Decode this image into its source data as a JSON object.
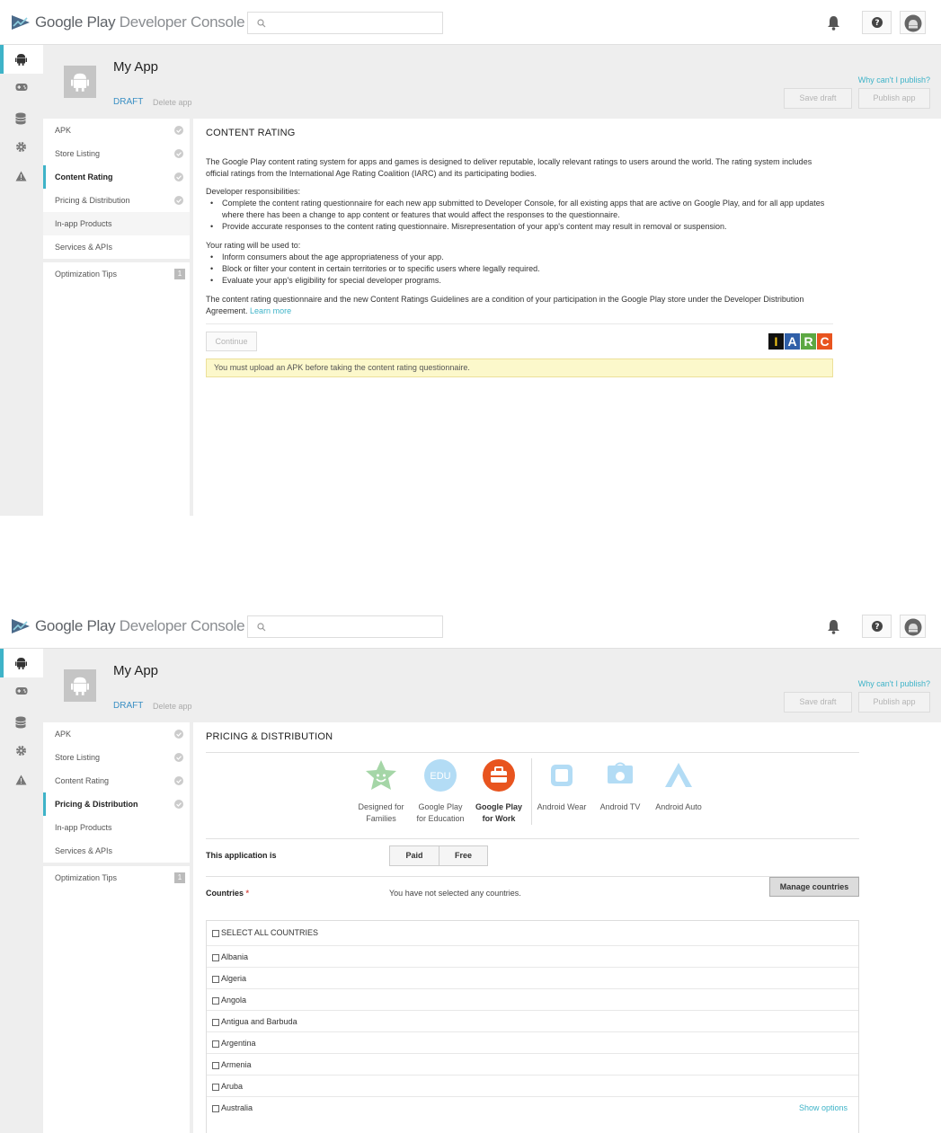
{
  "header": {
    "logo_google_play": "Google Play",
    "logo_dev_console": "Developer Console"
  },
  "app": {
    "title": "My App",
    "status": "DRAFT",
    "delete_label": "Delete app",
    "why_cant_publish": "Why can't I publish?",
    "save_draft": "Save draft",
    "publish_app": "Publish app"
  },
  "sidenav": {
    "items": [
      {
        "label": "APK"
      },
      {
        "label": "Store Listing"
      },
      {
        "label": "Content Rating"
      },
      {
        "label": "Pricing & Distribution"
      },
      {
        "label": "In-app Products"
      },
      {
        "label": "Services & APIs"
      }
    ],
    "optimization_tips": "Optimization Tips",
    "optimization_count": "1"
  },
  "content_rating": {
    "title": "CONTENT RATING",
    "intro": "The Google Play content rating system for apps and games is designed to deliver reputable, locally relevant ratings to users around the world. The rating system includes official ratings from the International Age Rating Coalition (IARC) and its participating bodies.",
    "dev_resp_heading": "Developer responsibilities:",
    "dev_resp": [
      "Complete the content rating questionnaire for each new app submitted to Developer Console, for all existing apps that are active on Google Play, and for all app updates where there has been a change to app content or features that would affect the responses to the questionnaire.",
      "Provide accurate responses to the content rating questionnaire. Misrepresentation of your app's content may result in removal or suspension."
    ],
    "usage_heading": "Your rating will be used to:",
    "usage": [
      "Inform consumers about the age appropriateness of your app.",
      "Block or filter your content in certain territories or to specific users where legally required.",
      "Evaluate your app's eligibility for special developer programs."
    ],
    "closing": "The content rating questionnaire and the new Content Ratings Guidelines are a condition of your participation in the Google Play store under the Developer Distribution Agreement.",
    "learn_more": "Learn more",
    "continue": "Continue",
    "iarc_letters": [
      "I",
      "A",
      "R",
      "C"
    ],
    "iarc_colors": [
      "#f7c815",
      "#2f5fa8",
      "#5ca842",
      "#e8541f"
    ],
    "notice": "You must upload an APK before taking the content rating questionnaire."
  },
  "pricing": {
    "title": "PRICING & DISTRIBUTION",
    "programs": [
      {
        "line1": "Designed for",
        "line2": "Families",
        "icon": "families-star-icon"
      },
      {
        "line1": "Google Play",
        "line2": "for Education",
        "icon": "edu-icon",
        "icon_text": "EDU"
      },
      {
        "line1": "Google Play",
        "line2": "for Work",
        "icon": "work-briefcase-icon"
      },
      {
        "line1": "Android Wear",
        "line2": "",
        "icon": "android-wear-icon"
      },
      {
        "line1": "Android TV",
        "line2": "",
        "icon": "android-tv-icon"
      },
      {
        "line1": "Android Auto",
        "line2": "",
        "icon": "android-auto-icon"
      }
    ],
    "app_is_label": "This application is",
    "paid": "Paid",
    "free": "Free",
    "countries_label": "Countries",
    "required_mark": "*",
    "no_countries": "You have not selected any countries.",
    "manage_countries": "Manage countries",
    "select_all": "SELECT ALL COUNTRIES",
    "countries": [
      "Albania",
      "Algeria",
      "Angola",
      "Antigua and Barbuda",
      "Argentina",
      "Armenia",
      "Aruba",
      "Australia"
    ],
    "show_options": "Show options"
  }
}
